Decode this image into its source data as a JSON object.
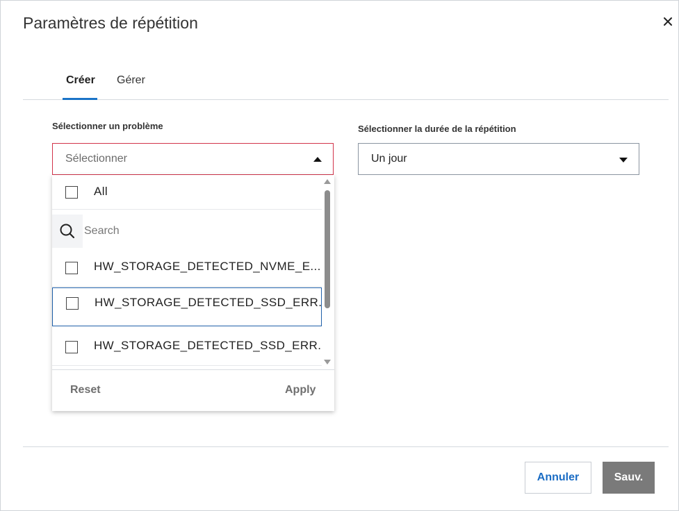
{
  "dialog": {
    "title": "Paramètres de répétition",
    "close_icon": "close-icon"
  },
  "tabs": [
    {
      "label": "Créer",
      "active": true
    },
    {
      "label": "Gérer",
      "active": false
    }
  ],
  "problem": {
    "label": "Sélectionner un problème",
    "placeholder": "Sélectionner",
    "expanded": true
  },
  "dropdown": {
    "all_label": "All",
    "search_placeholder": "Search",
    "items": [
      {
        "label": "HW_STORAGE_DETECTED_NVME_E...",
        "checked": false,
        "focused": false
      },
      {
        "label": "HW_STORAGE_DETECTED_SSD_ERR...",
        "checked": false,
        "focused": true
      },
      {
        "label": "HW_STORAGE_DETECTED_SSD_ERR...",
        "checked": false,
        "focused": false
      }
    ],
    "reset_label": "Reset",
    "apply_label": "Apply"
  },
  "duration": {
    "label": "Sélectionner la durée de la répétition",
    "value": "Un jour"
  },
  "footer": {
    "cancel_label": "Annuler",
    "save_label": "Sauv."
  },
  "colors": {
    "accent": "#1a73c7",
    "error_border": "#d2334a",
    "save_bg": "#7a7a7a",
    "cancel_text": "#1a6cc4"
  }
}
